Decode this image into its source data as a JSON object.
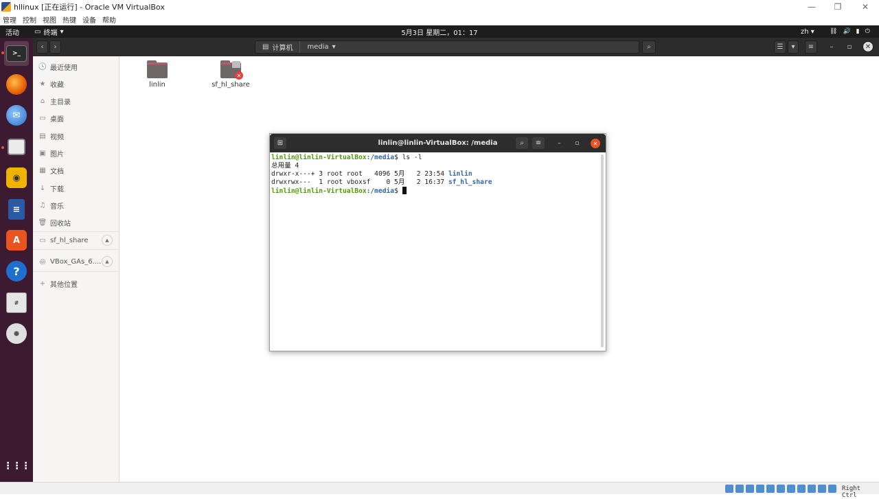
{
  "host": {
    "title": "hllinux [正在运行] - Oracle VM VirtualBox",
    "menu": [
      "管理",
      "控制",
      "视图",
      "热键",
      "设备",
      "帮助"
    ],
    "controls": {
      "minimize": "—",
      "maximize": "❐",
      "close": "✕"
    },
    "status": {
      "host_key": "Right Ctrl"
    }
  },
  "topbar": {
    "activities": "活动",
    "app_name": "终端",
    "clock": "5月3日 星期二，01：17",
    "language": "zh",
    "tray": [
      "⛓",
      "🔊",
      "▮",
      "⏻"
    ]
  },
  "dock": {
    "items": [
      {
        "name": "terminal",
        "color": "#2b2b2b"
      },
      {
        "name": "firefox",
        "color": "#e66000"
      },
      {
        "name": "thunderbird",
        "color": "#2a6fc9"
      },
      {
        "name": "files",
        "color": "#e4e4e4"
      },
      {
        "name": "rhythmbox",
        "color": "#f0b400"
      },
      {
        "name": "writer",
        "color": "#2a5aa6"
      },
      {
        "name": "software",
        "color": "#e95420"
      },
      {
        "name": "help",
        "color": "#1f6fce"
      },
      {
        "name": "sudoku",
        "color": "#e0e0e0"
      },
      {
        "name": "disc",
        "color": "#d8d8d8"
      }
    ],
    "apps_grid": "⋮⋮⋮"
  },
  "nautilus": {
    "path": [
      {
        "label": "计算机"
      },
      {
        "label": "media"
      }
    ],
    "sidebar": [
      {
        "label": "最近使用",
        "icon": "🕓"
      },
      {
        "label": "收藏",
        "icon": "★"
      },
      {
        "label": "主目录",
        "icon": "⌂"
      },
      {
        "label": "桌面",
        "icon": "▭"
      },
      {
        "label": "视频",
        "icon": "▤"
      },
      {
        "label": "图片",
        "icon": "▣"
      },
      {
        "label": "文档",
        "icon": "▦"
      },
      {
        "label": "下载",
        "icon": "↓"
      },
      {
        "label": "音乐",
        "icon": "♫"
      },
      {
        "label": "回收站",
        "icon": "🗑"
      },
      {
        "label": "sf_hl_share",
        "icon": "▭"
      },
      {
        "label": "VBox_GAs_6....",
        "icon": "◎"
      },
      {
        "label": "其他位置",
        "icon": "+"
      }
    ],
    "files": [
      {
        "label": "linlin"
      },
      {
        "label": "sf_hl_share",
        "badge": "✕"
      }
    ]
  },
  "terminal": {
    "title": "linlin@linlin-VirtualBox: /media",
    "prompt_user": "linlin@linlin-VirtualBox",
    "prompt_path": ":/media",
    "prompt_sym": "$ ",
    "command": "ls -l",
    "total": "总用量 4",
    "rows": [
      {
        "meta": "drwxr-x---+ 3 root root   4096 5月   2 23:54 ",
        "name": "linlin"
      },
      {
        "meta": "drwxrwx---  1 root vboxsf    0 5月   2 16:37 ",
        "name": "sf_hl_share"
      }
    ]
  }
}
